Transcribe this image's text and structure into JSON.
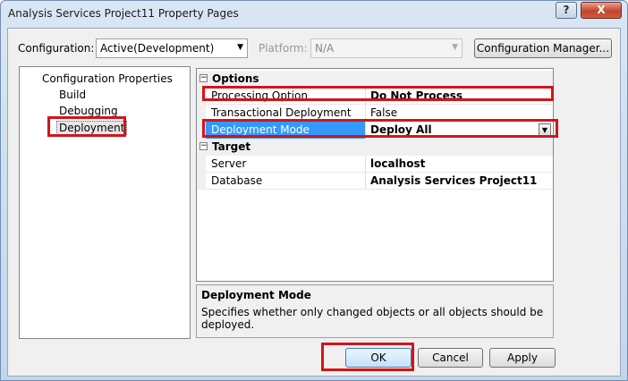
{
  "window": {
    "title": "Analysis Services Project11 Property Pages",
    "help_label": "?",
    "close_label": "X"
  },
  "toolbar": {
    "configuration_label": "Configuration:",
    "configuration_value": "Active(Development)",
    "platform_label": "Platform:",
    "platform_value": "N/A",
    "config_manager_label": "Configuration Manager..."
  },
  "tree": {
    "root": "Configuration Properties",
    "items": [
      {
        "label": "Build"
      },
      {
        "label": "Debugging"
      },
      {
        "label": "Deployment",
        "selected": true
      }
    ]
  },
  "grid": {
    "categories": [
      {
        "label": "Options",
        "toggle": "⊟",
        "properties": [
          {
            "name": "Processing Option",
            "value": "Do Not Process",
            "bold": true
          },
          {
            "name": "Transactional Deployment",
            "value": "False",
            "bold": false
          },
          {
            "name": "Deployment Mode",
            "value": "Deploy All",
            "bold": true,
            "selected": true
          }
        ]
      },
      {
        "label": "Target",
        "toggle": "⊟",
        "properties": [
          {
            "name": "Server",
            "value": "localhost",
            "bold": true
          },
          {
            "name": "Database",
            "value": "Analysis Services Project11",
            "bold": true
          }
        ]
      }
    ]
  },
  "description": {
    "title": "Deployment Mode",
    "text": "Specifies whether only changed objects or all objects should be deployed."
  },
  "buttons": {
    "ok": "OK",
    "cancel": "Cancel",
    "apply": "Apply"
  },
  "icons": {
    "dropdown": "chevron-down-icon",
    "collapse": "minus-box-icon"
  },
  "colors": {
    "highlight": "#d3141a",
    "selection": "#3399ff"
  }
}
